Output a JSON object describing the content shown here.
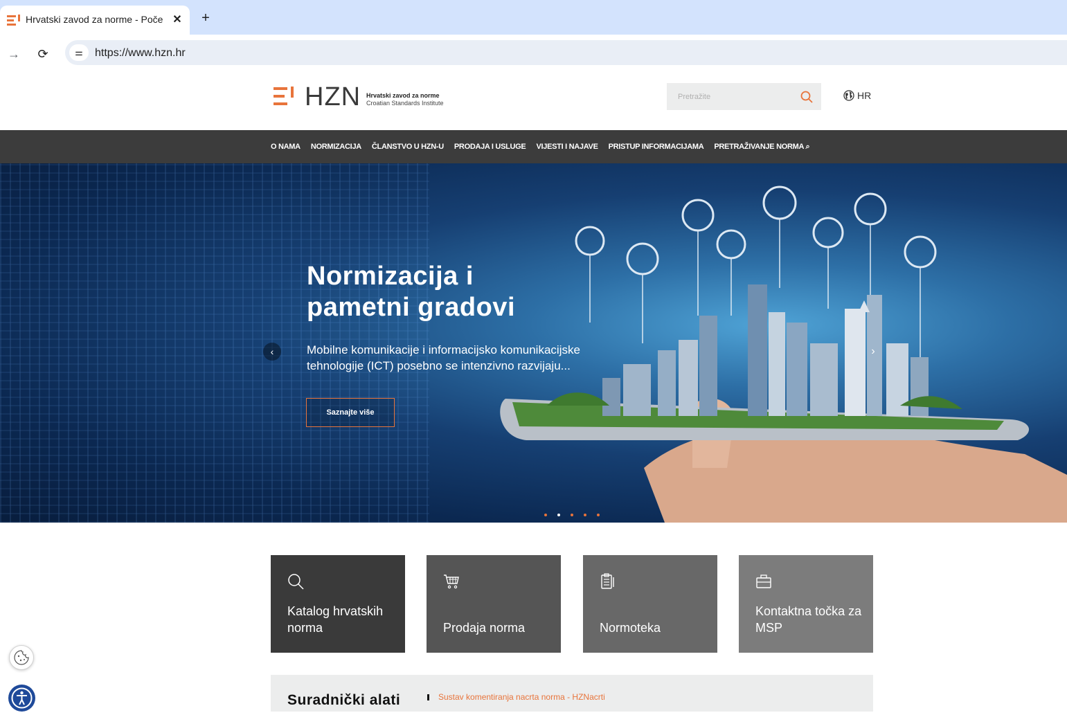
{
  "browser": {
    "tab_title": "Hrvatski zavod za norme - Poče",
    "tab_close": "✕",
    "new_tab": "+",
    "url": "https://www.hzn.hr"
  },
  "header": {
    "logo_text": "HZN",
    "logo_subtitle_1": "Hrvatski zavod za norme",
    "logo_subtitle_2": "Croatian Standards Institute",
    "search_placeholder": "Pretražite",
    "language": "HR"
  },
  "nav": {
    "items": [
      "O NAMA",
      "NORMIZACIJA",
      "ČLANSTVO U HZN-U",
      "PRODAJA I USLUGE",
      "VIJESTI I NAJAVE",
      "PRISTUP INFORMACIJAMA",
      "PRETRAŽIVANJE NORMA ⌕"
    ]
  },
  "hero": {
    "title_line1": "Normizacija i",
    "title_line2": "pametni gradovi",
    "text": "Mobilne komunikacije i informacijsko komunikacijske tehnologije (ICT) posebno se intenzivno razvijaju...",
    "button": "Saznajte više",
    "prev": "‹",
    "next": "›",
    "slide_count": 5,
    "active_slide": 2
  },
  "tiles": [
    {
      "label": "Katalog hrvatskih norma",
      "icon": "search-icon"
    },
    {
      "label": "Prodaja norma",
      "icon": "cart-icon"
    },
    {
      "label": "Normoteka",
      "icon": "document-icon"
    },
    {
      "label": "Kontaktna točka za MSP",
      "icon": "briefcase-icon"
    }
  ],
  "collab": {
    "title": "Suradnički alati",
    "link": "Sustav komentiranja nacrta norma - HZNacrti"
  },
  "colors": {
    "accent": "#e8743b",
    "nav_bg": "#3c3c3c"
  }
}
